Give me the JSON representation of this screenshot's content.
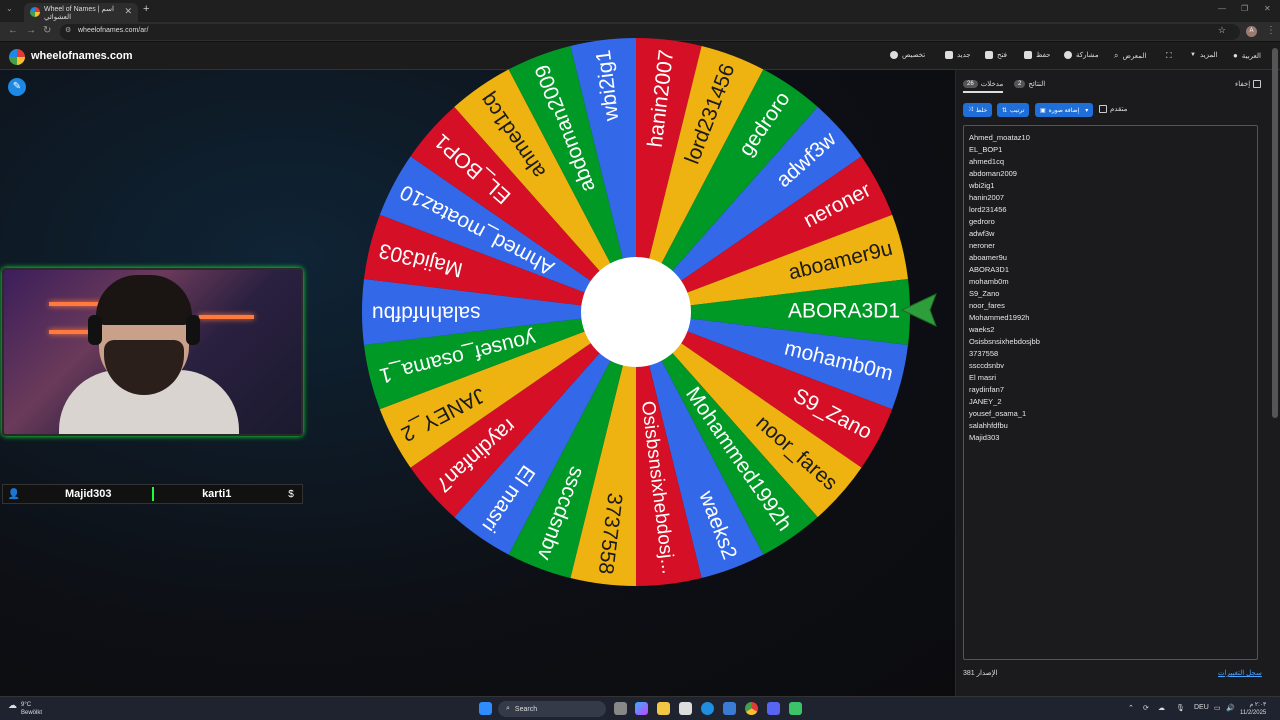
{
  "browser": {
    "tab_title": "Wheel of Names | اسم العشوائي",
    "url": "wheelofnames.com/ar/",
    "profile_initial": "A"
  },
  "site": {
    "logo_text": "wheelofnames.com",
    "menu": {
      "premium": "المزيد",
      "more": "المزيد",
      "fullscreen": "",
      "gallery": "المعرض",
      "share": "مشاركة",
      "save": "حفظ",
      "open": "فتح",
      "new": "جديد",
      "customize": "تخصيص",
      "language": "العربية"
    }
  },
  "wheel": {
    "entries": [
      "Ahmed_moataz10",
      "EL_BOP1",
      "ahmed1cq",
      "abdoman2009",
      "wbi2ig1",
      "hanin2007",
      "lord231456",
      "gedroro",
      "adwf3w",
      "neroner",
      "aboamer9u",
      "ABORA3D1",
      "mohamb0m",
      "S9_Zano",
      "noor_fares",
      "Mohammed1992h",
      "waeks2",
      "Osisbsnsixhebdosj...",
      "3737558",
      "ssccdsnbv",
      "El masri",
      "raydinfan7",
      "JANEY_2",
      "yousef_osama_1",
      "salahhfdfbu",
      "Majid303"
    ],
    "colors": [
      "#3369e8",
      "#d50f25",
      "#eeb211",
      "#009925"
    ]
  },
  "webcam": {
    "left_name": "Majid303",
    "right_name": "karti1",
    "user_icon": "user-icon",
    "dollar_icon": "$"
  },
  "panel": {
    "tab_entries_label": "مدخلات",
    "tab_entries_count": "26",
    "tab_results_label": "النتائج",
    "tab_results_count": "2",
    "hide_label": "إخفاء",
    "shuffle_label": "خلط",
    "sort_label": "ترتيب",
    "add_image_label": "إضافة صورة",
    "advanced_label": "متقدم",
    "entries": [
      "Ahmed_moataz10",
      "EL_BOP1",
      "ahmed1cq",
      "abdoman2009",
      "wbi2ig1",
      "hanin2007",
      "lord231456",
      "gedroro",
      "adwf3w",
      "neroner",
      "aboamer9u",
      "ABORA3D1",
      "mohamb0m",
      "S9_Zano",
      "noor_fares",
      "Mohammed1992h",
      "waeks2",
      "Osisbsnsixhebdosjbb",
      "3737558",
      "ssccdsnbv",
      "El masri",
      "raydinfan7",
      "JANEY_2",
      "yousef_osama_1",
      "salahhfdfbu",
      "Majid303"
    ],
    "version": "الإصدار 381",
    "changelog": "سجل التغييرات"
  },
  "taskbar": {
    "temperature": "9°C",
    "weather_desc": "Bewölkt",
    "search_label": "Search",
    "language": "DEU",
    "time": "٢:٠٣ م",
    "date": "11/2/2025"
  }
}
